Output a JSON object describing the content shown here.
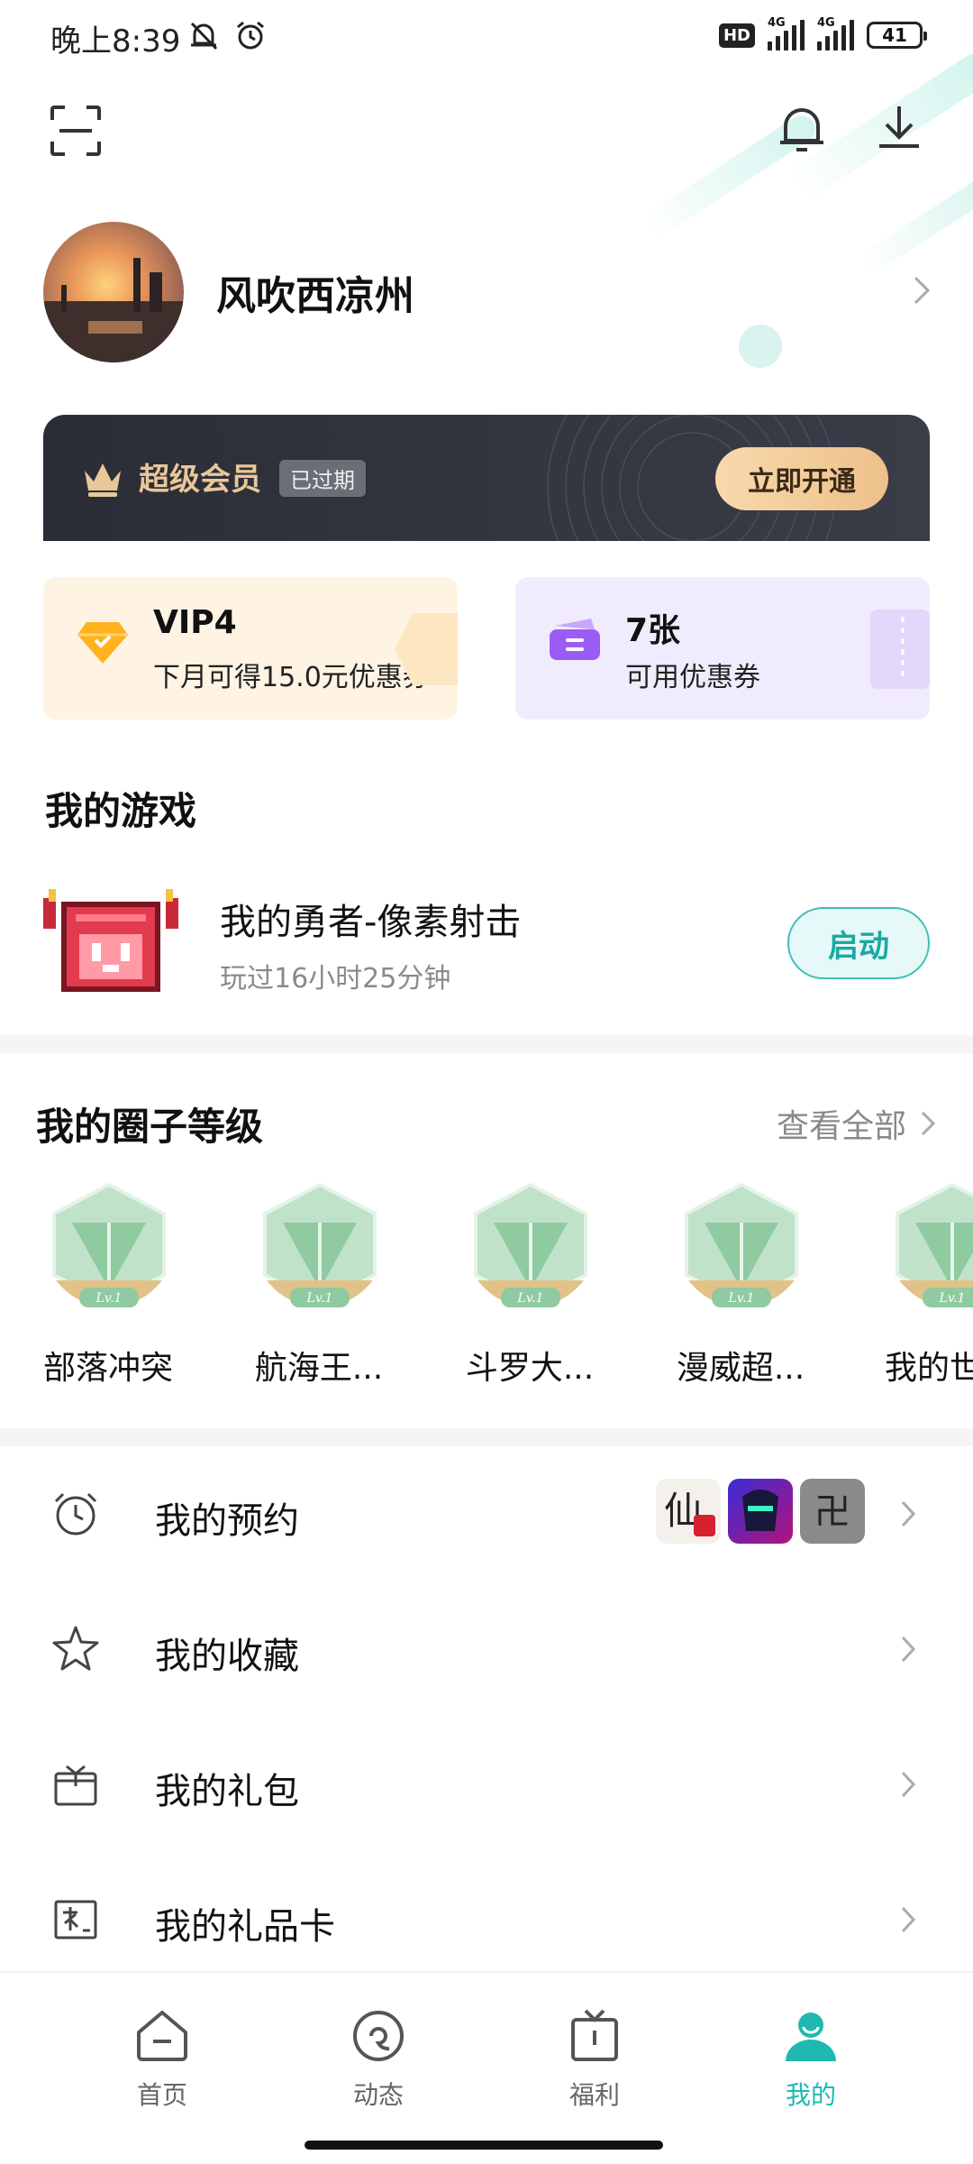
{
  "status_bar": {
    "time": "晚上8:39",
    "network_badge": "HD",
    "network_type": "4G",
    "battery_level": "41"
  },
  "header": {
    "icons": [
      "scan-icon",
      "bell-icon",
      "download-icon"
    ]
  },
  "profile": {
    "username": "风吹西凉州"
  },
  "vip_banner": {
    "title": "超级会员",
    "status": "已过期",
    "button_label": "立即开通",
    "title_color": "#e9c79b"
  },
  "cards": {
    "vip": {
      "title": "VIP4",
      "subtitle": "下月可得15.0元优惠券"
    },
    "coupon": {
      "title": "7张",
      "subtitle": "可用优惠券"
    }
  },
  "my_games": {
    "title": "我的游戏",
    "game": {
      "name": "我的勇者-像素射击",
      "played_time": "玩过16小时25分钟",
      "button_label": "启动"
    }
  },
  "circles": {
    "title": "我的圈子等级",
    "view_all": "查看全部",
    "items": [
      {
        "name": "部落冲突",
        "level": "Lv.1"
      },
      {
        "name": "航海王...",
        "level": "Lv.1"
      },
      {
        "name": "斗罗大...",
        "level": "Lv.1"
      },
      {
        "name": "漫威超...",
        "level": "Lv.1"
      },
      {
        "name": "我的世",
        "level": "Lv.1"
      }
    ]
  },
  "menu": {
    "items": [
      {
        "label": "我的预约",
        "icon": "alarm-clock-icon"
      },
      {
        "label": "我的收藏",
        "icon": "star-icon"
      },
      {
        "label": "我的礼包",
        "icon": "gift-box-icon"
      },
      {
        "label": "我的礼品卡",
        "icon": "gift-card-icon"
      }
    ],
    "reservation_thumbs": [
      "仙",
      "",
      "卍"
    ]
  },
  "bottom_nav": {
    "items": [
      {
        "label": "首页",
        "icon": "home-icon"
      },
      {
        "label": "动态",
        "icon": "feed-icon"
      },
      {
        "label": "福利",
        "icon": "gift-icon"
      },
      {
        "label": "我的",
        "icon": "profile-icon",
        "active": true
      }
    ],
    "active_color": "#1fb9b1"
  }
}
